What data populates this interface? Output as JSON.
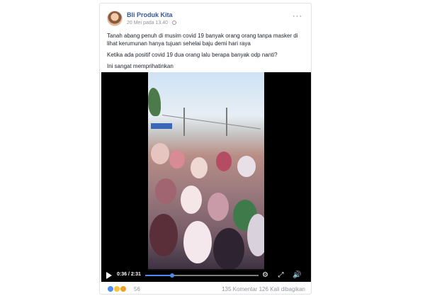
{
  "post": {
    "page_name": "Bli Produk Kita",
    "meta": "20 Mei pada 13.40 ·",
    "more": "···",
    "paragraphs": [
      "Tanah abang penuh di musim covid 19 banyak orang orang tanpa masker di lihat kerumunan hanya tujuan sehelai baju demi hari raya",
      "Ketika ada positif covid 19 dua orang lalu berapa banyak odp nanti?",
      "Ini sangat memprihatinkan"
    ]
  },
  "video": {
    "time": "0:36 / 2:31",
    "progress": 0.24
  },
  "footer": {
    "reaction_count": "56",
    "comments": "135 Komentar",
    "shares": "126 Kali dibagikan"
  },
  "colors": {
    "link": "#385898",
    "progress": "#4a8ef0",
    "like": "#4a8ef0",
    "haha": "#f7c33c"
  }
}
